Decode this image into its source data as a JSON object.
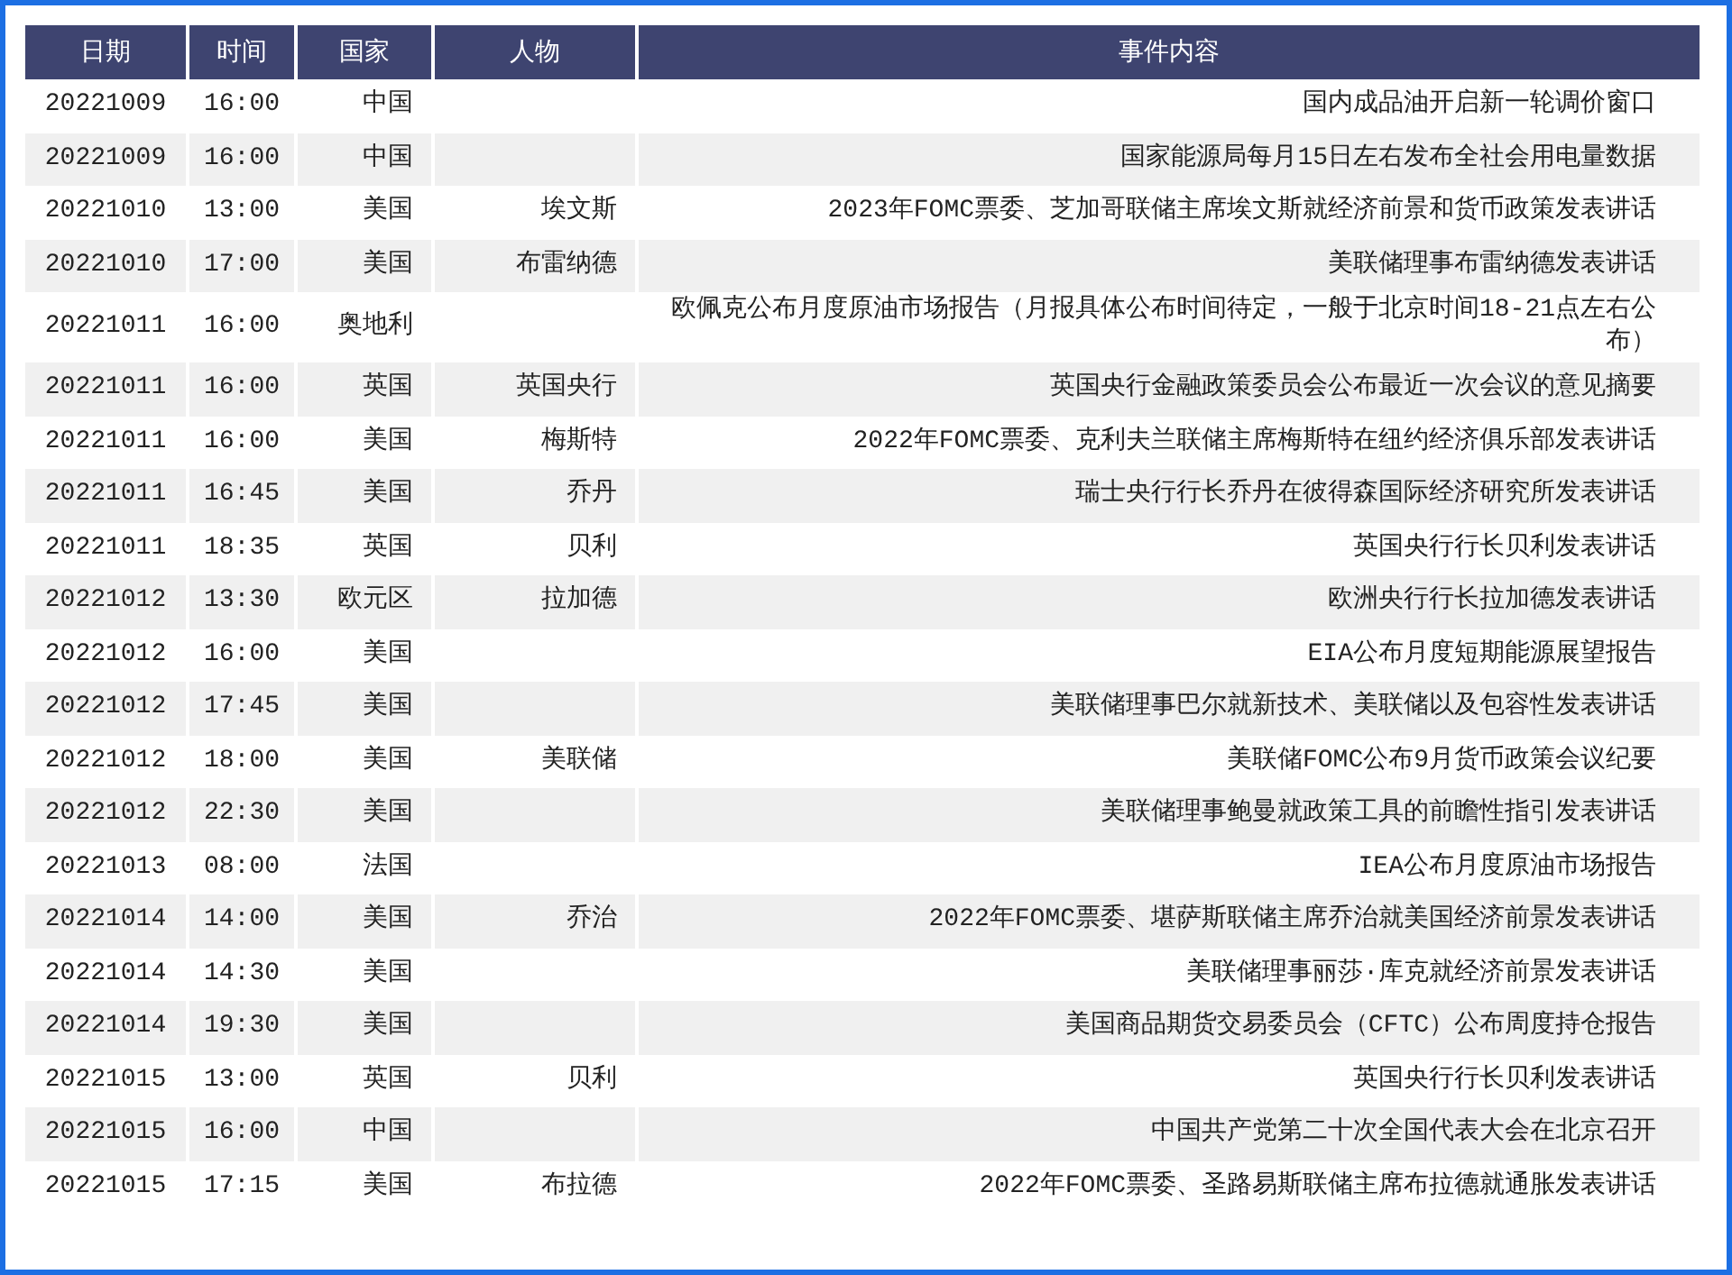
{
  "table": {
    "columns": [
      "日期",
      "时间",
      "国家",
      "人物",
      "事件内容"
    ],
    "rows": [
      {
        "date": "20221009",
        "time": "16:00",
        "country": "中国",
        "event": "国内成品油开启新一轮调价窗口"
      },
      {
        "date": "20221009",
        "time": "16:00",
        "country": "中国",
        "event": "国家能源局每月15日左右发布全社会用电量数据"
      },
      {
        "date": "20221010",
        "time": "13:00",
        "country": "美国",
        "person": "埃文斯",
        "event": "2023年FOMC票委、芝加哥联储主席埃文斯就经济前景和货币政策发表讲话"
      },
      {
        "date": "20221010",
        "time": "17:00",
        "country": "美国",
        "person": "布雷纳德",
        "event": "美联储理事布雷纳德发表讲话"
      },
      {
        "date": "20221011",
        "time": "16:00",
        "country": "奥地利",
        "event": "欧佩克公布月度原油市场报告（月报具体公布时间待定，一般于北京时间18-21点左右公布）"
      },
      {
        "date": "20221011",
        "time": "16:00",
        "country": "英国",
        "person": "英国央行",
        "event": "英国央行金融政策委员会公布最近一次会议的意见摘要"
      },
      {
        "date": "20221011",
        "time": "16:00",
        "country": "美国",
        "person": "梅斯特",
        "event": "2022年FOMC票委、克利夫兰联储主席梅斯特在纽约经济俱乐部发表讲话"
      },
      {
        "date": "20221011",
        "time": "16:45",
        "country": "美国",
        "person": "乔丹",
        "event": "瑞士央行行长乔丹在彼得森国际经济研究所发表讲话"
      },
      {
        "date": "20221011",
        "time": "18:35",
        "country": "英国",
        "person": "贝利",
        "event": "英国央行行长贝利发表讲话"
      },
      {
        "date": "20221012",
        "time": "13:30",
        "country": "欧元区",
        "person": "拉加德",
        "event": "欧洲央行行长拉加德发表讲话"
      },
      {
        "date": "20221012",
        "time": "16:00",
        "country": "美国",
        "event": "EIA公布月度短期能源展望报告"
      },
      {
        "date": "20221012",
        "time": "17:45",
        "country": "美国",
        "event": "美联储理事巴尔就新技术、美联储以及包容性发表讲话"
      },
      {
        "date": "20221012",
        "time": "18:00",
        "country": "美国",
        "person": "美联储",
        "event": "美联储FOMC公布9月货币政策会议纪要"
      },
      {
        "date": "20221012",
        "time": "22:30",
        "country": "美国",
        "event": "美联储理事鲍曼就政策工具的前瞻性指引发表讲话"
      },
      {
        "date": "20221013",
        "time": "08:00",
        "country": "法国",
        "event": "IEA公布月度原油市场报告"
      },
      {
        "date": "20221014",
        "time": "14:00",
        "country": "美国",
        "person": "乔治",
        "event": "2022年FOMC票委、堪萨斯联储主席乔治就美国经济前景发表讲话"
      },
      {
        "date": "20221014",
        "time": "14:30",
        "country": "美国",
        "event": "美联储理事丽莎·库克就经济前景发表讲话"
      },
      {
        "date": "20221014",
        "time": "19:30",
        "country": "美国",
        "event": "美国商品期货交易委员会（CFTC）公布周度持仓报告"
      },
      {
        "date": "20221015",
        "time": "13:00",
        "country": "英国",
        "person": "贝利",
        "event": "英国央行行长贝利发表讲话"
      },
      {
        "date": "20221015",
        "time": "16:00",
        "country": "中国",
        "event": "中国共产党第二十次全国代表大会在北京召开"
      },
      {
        "date": "20221015",
        "time": "17:15",
        "country": "美国",
        "person": "布拉德",
        "event": "2022年FOMC票委、圣路易斯联储主席布拉德就通胀发表讲话"
      }
    ]
  }
}
